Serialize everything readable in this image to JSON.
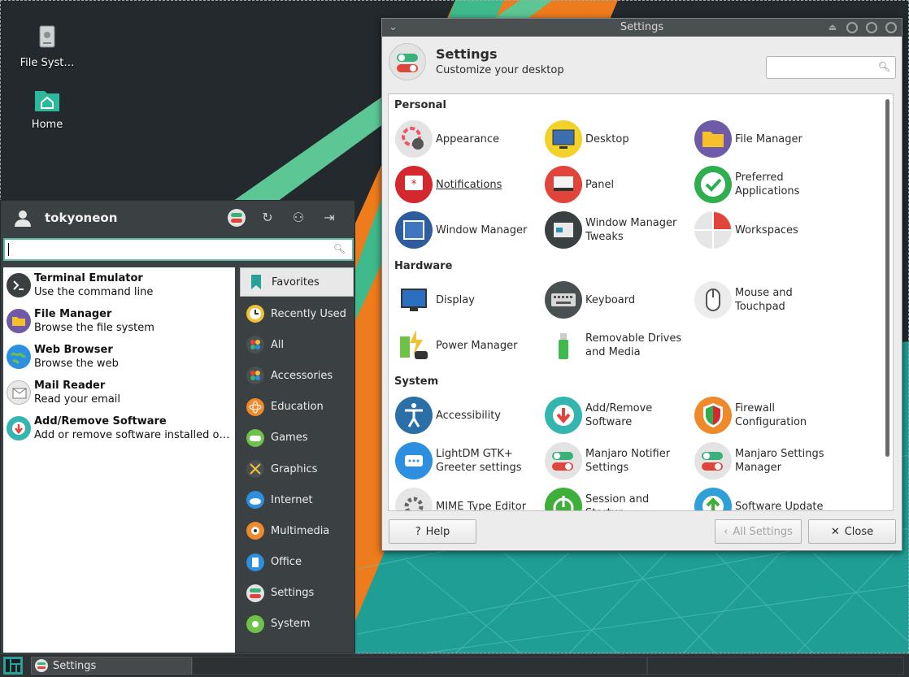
{
  "desktop": {
    "icons": [
      {
        "label": "File Syst…",
        "icon": "drive-icon"
      },
      {
        "label": "Home",
        "icon": "home-folder-icon"
      }
    ]
  },
  "settings_window": {
    "title": "Settings",
    "header_title": "Settings",
    "header_subtitle": "Customize your desktop",
    "search_placeholder": "",
    "categories": [
      {
        "name": "Personal",
        "items": [
          "Appearance",
          "Desktop",
          "File Manager",
          "Notifications",
          "Panel",
          "Preferred Applications",
          "Window Manager",
          "Window Manager\nTweaks",
          "Workspaces"
        ]
      },
      {
        "name": "Hardware",
        "items": [
          "Display",
          "Keyboard",
          "Mouse and Touchpad",
          "Power Manager",
          "Removable Drives\nand Media"
        ]
      },
      {
        "name": "System",
        "items": [
          "Accessibility",
          "Add/Remove\nSoftware",
          "Firewall Configuration",
          "LightDM GTK+\nGreeter settings",
          "Manjaro Notifier\nSettings",
          "Manjaro Settings\nManager",
          "MIME Type Editor",
          "Session and Startup",
          "Software Update"
        ]
      }
    ],
    "buttons": {
      "help": "Help",
      "all_settings": "All Settings",
      "close": "Close"
    }
  },
  "menu": {
    "username": "tokyoneon",
    "search_value": "",
    "favorites": [
      {
        "name": "Terminal Emulator",
        "desc": "Use the command line"
      },
      {
        "name": "File Manager",
        "desc": "Browse the file system"
      },
      {
        "name": "Web Browser",
        "desc": "Browse the web"
      },
      {
        "name": "Mail Reader",
        "desc": "Read your email"
      },
      {
        "name": "Add/Remove Software",
        "desc": "Add or remove software installed on th…"
      }
    ],
    "categories": [
      "Favorites",
      "Recently Used",
      "All",
      "Accessories",
      "Education",
      "Games",
      "Graphics",
      "Internet",
      "Multimedia",
      "Office",
      "Settings",
      "System"
    ],
    "selected_category": "Favorites"
  },
  "taskbar": {
    "tasks": [
      {
        "label": "Settings"
      }
    ]
  },
  "colors": {
    "accent": "#5fb9a8",
    "wallpaper_teal": "#2aa198",
    "wallpaper_orange": "#f07d1a",
    "panel_dark": "#3b4043"
  }
}
